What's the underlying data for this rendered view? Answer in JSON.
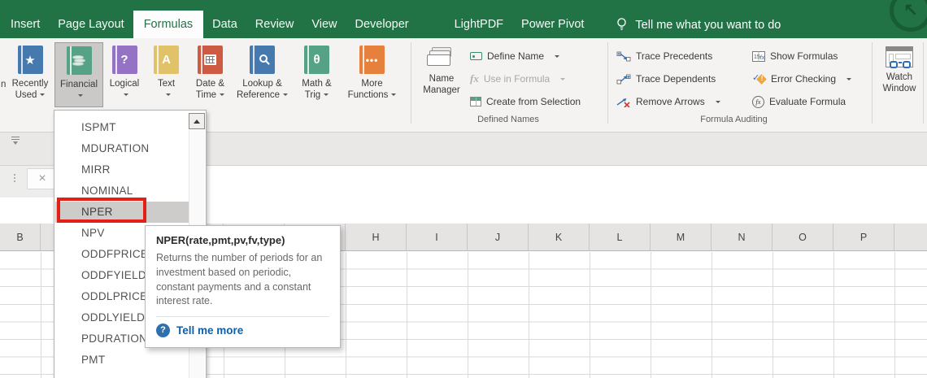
{
  "menubar": {
    "tabs": [
      "Insert",
      "Page Layout",
      "Formulas",
      "Data",
      "Review",
      "View",
      "Developer",
      "LightPDF",
      "Power Pivot"
    ],
    "active_tab": "Formulas",
    "tell_me": "Tell me what you want to do"
  },
  "ribbon": {
    "partial_label": "n",
    "library": [
      {
        "l1": "Recently",
        "l2": "Used"
      },
      {
        "l1": "Financial",
        "l2": ""
      },
      {
        "l1": "Logical",
        "l2": ""
      },
      {
        "l1": "Text",
        "l2": ""
      },
      {
        "l1": "Date &",
        "l2": "Time"
      },
      {
        "l1": "Lookup &",
        "l2": "Reference"
      },
      {
        "l1": "Math &",
        "l2": "Trig"
      },
      {
        "l1": "More",
        "l2": "Functions"
      }
    ],
    "name_manager": {
      "l1": "Name",
      "l2": "Manager"
    },
    "defined_names": {
      "group": "Defined Names",
      "items": [
        "Define Name",
        "Use in Formula",
        "Create from Selection"
      ]
    },
    "auditing": {
      "group": "Formula Auditing",
      "col1": [
        "Trace Precedents",
        "Trace Dependents",
        "Remove Arrows"
      ],
      "col2": [
        "Show Formulas",
        "Error Checking",
        "Evaluate Formula"
      ]
    },
    "watch_window": {
      "l1": "Watch",
      "l2": "Window"
    }
  },
  "dropdown": {
    "items": [
      "ISPMT",
      "MDURATION",
      "MIRR",
      "NOMINAL",
      "NPER",
      "NPV",
      "ODDFPRICE",
      "ODDFYIELD",
      "ODDLPRICE",
      "ODDLYIELD",
      "PDURATION",
      "PMT"
    ],
    "selected": "NPER"
  },
  "tooltip": {
    "title": "NPER(rate,pmt,pv,fv,type)",
    "body": "Returns the number of periods for an investment based on periodic, constant payments and a constant interest rate.",
    "link": "Tell me more"
  },
  "sheet": {
    "columns": [
      "B",
      "H",
      "I",
      "J",
      "K",
      "L",
      "M",
      "N",
      "O",
      "P"
    ]
  },
  "glyphs": {
    "star": "★",
    "question": "?",
    "letter_a": "A",
    "theta": "θ",
    "ellipsis": "•••",
    "fx": "fx",
    "cancel": "×",
    "arrow_nw": "↖",
    "qmark": "?",
    "show_formulas_fx": "fx",
    "exclaim": "!",
    "check": "✓"
  },
  "colors": {
    "excel_green": "#217346",
    "selection_red": "#e32017",
    "highlight_gray": "#cecccb",
    "link_blue": "#0f5fa8"
  }
}
